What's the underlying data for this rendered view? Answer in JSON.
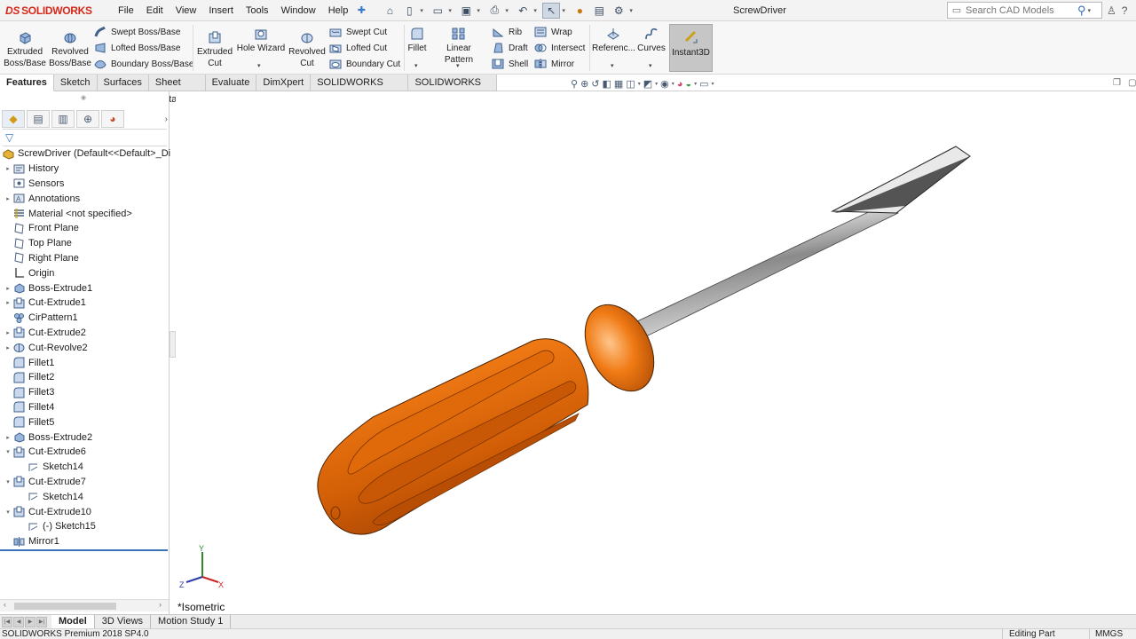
{
  "app": {
    "logo_ds": "DS",
    "logo_text": "SOLIDWORKS",
    "document_title": "ScrewDriver",
    "colors": {
      "brand_red": "#d5281b",
      "handle_orange": "#f07a14",
      "accent_blue": "#3b73b9"
    }
  },
  "menu": [
    "File",
    "Edit",
    "View",
    "Insert",
    "Tools",
    "Window",
    "Help"
  ],
  "search": {
    "placeholder": "Search CAD Models"
  },
  "ribbon": {
    "extruded_boss": "Extruded Boss/Base",
    "revolved_boss": "Revolved Boss/Base",
    "swept_boss": "Swept Boss/Base",
    "lofted_boss": "Lofted Boss/Base",
    "boundary_boss": "Boundary Boss/Base",
    "extruded_cut": "Extruded Cut",
    "hole_wizard": "Hole Wizard",
    "revolved_cut": "Revolved Cut",
    "swept_cut": "Swept Cut",
    "lofted_cut": "Lofted Cut",
    "boundary_cut": "Boundary Cut",
    "fillet": "Fillet",
    "linear_pattern": "Linear Pattern",
    "rib": "Rib",
    "draft": "Draft",
    "shell": "Shell",
    "wrap": "Wrap",
    "intersect": "Intersect",
    "mirror": "Mirror",
    "reference": "Referenc...",
    "curves": "Curves",
    "instant3d": "Instant3D"
  },
  "tabs": [
    "Features",
    "Sketch",
    "Surfaces",
    "Sheet Metal",
    "Evaluate",
    "DimXpert",
    "SOLIDWORKS Add-Ins",
    "SOLIDWORKS MBD"
  ],
  "tree": {
    "root": "ScrewDriver  (Default<<Default>_Di",
    "items": [
      {
        "label": "History",
        "icon": "history-folder-icon",
        "exp": "▸",
        "indent": 0
      },
      {
        "label": "Sensors",
        "icon": "sensors-icon",
        "exp": "",
        "indent": 0
      },
      {
        "label": "Annotations",
        "icon": "annotations-icon",
        "exp": "▸",
        "indent": 0
      },
      {
        "label": "Material <not specified>",
        "icon": "material-icon",
        "exp": "",
        "indent": 0
      },
      {
        "label": "Front Plane",
        "icon": "plane-icon",
        "exp": "",
        "indent": 0
      },
      {
        "label": "Top Plane",
        "icon": "plane-icon",
        "exp": "",
        "indent": 0
      },
      {
        "label": "Right Plane",
        "icon": "plane-icon",
        "exp": "",
        "indent": 0
      },
      {
        "label": "Origin",
        "icon": "origin-icon",
        "exp": "",
        "indent": 0
      },
      {
        "label": "Boss-Extrude1",
        "icon": "boss-extrude-icon",
        "exp": "▸",
        "indent": 0
      },
      {
        "label": "Cut-Extrude1",
        "icon": "cut-extrude-icon",
        "exp": "▸",
        "indent": 0
      },
      {
        "label": "CirPattern1",
        "icon": "circular-pattern-icon",
        "exp": "",
        "indent": 0
      },
      {
        "label": "Cut-Extrude2",
        "icon": "cut-extrude-icon",
        "exp": "▸",
        "indent": 0
      },
      {
        "label": "Cut-Revolve2",
        "icon": "cut-revolve-icon",
        "exp": "▸",
        "indent": 0
      },
      {
        "label": "Fillet1",
        "icon": "fillet-icon",
        "exp": "",
        "indent": 0
      },
      {
        "label": "Fillet2",
        "icon": "fillet-icon",
        "exp": "",
        "indent": 0
      },
      {
        "label": "Fillet3",
        "icon": "fillet-icon",
        "exp": "",
        "indent": 0
      },
      {
        "label": "Fillet4",
        "icon": "fillet-icon",
        "exp": "",
        "indent": 0
      },
      {
        "label": "Fillet5",
        "icon": "fillet-icon",
        "exp": "",
        "indent": 0
      },
      {
        "label": "Boss-Extrude2",
        "icon": "boss-extrude-icon",
        "exp": "▸",
        "indent": 0
      },
      {
        "label": "Cut-Extrude6",
        "icon": "cut-extrude-icon",
        "exp": "▾",
        "indent": 0
      },
      {
        "label": "Sketch14",
        "icon": "sketch-icon",
        "exp": "",
        "indent": 1
      },
      {
        "label": "Cut-Extrude7",
        "icon": "cut-extrude-icon",
        "exp": "▾",
        "indent": 0
      },
      {
        "label": "Sketch14",
        "icon": "sketch-icon",
        "exp": "",
        "indent": 1
      },
      {
        "label": "Cut-Extrude10",
        "icon": "cut-extrude-icon",
        "exp": "▾",
        "indent": 0
      },
      {
        "label": "(-) Sketch15",
        "icon": "sketch-icon",
        "exp": "",
        "indent": 1
      },
      {
        "label": "Mirror1",
        "icon": "mirror-icon",
        "exp": "",
        "indent": 0
      }
    ]
  },
  "viewport": {
    "view_label": "*Isometric",
    "triad": {
      "x": "X",
      "y": "Y",
      "z": "Z"
    }
  },
  "bottom_tabs": [
    "Model",
    "3D Views",
    "Motion Study 1"
  ],
  "status": {
    "left": "SOLIDWORKS Premium 2018 SP4.0",
    "mode": "Editing Part",
    "units": "MMGS"
  }
}
